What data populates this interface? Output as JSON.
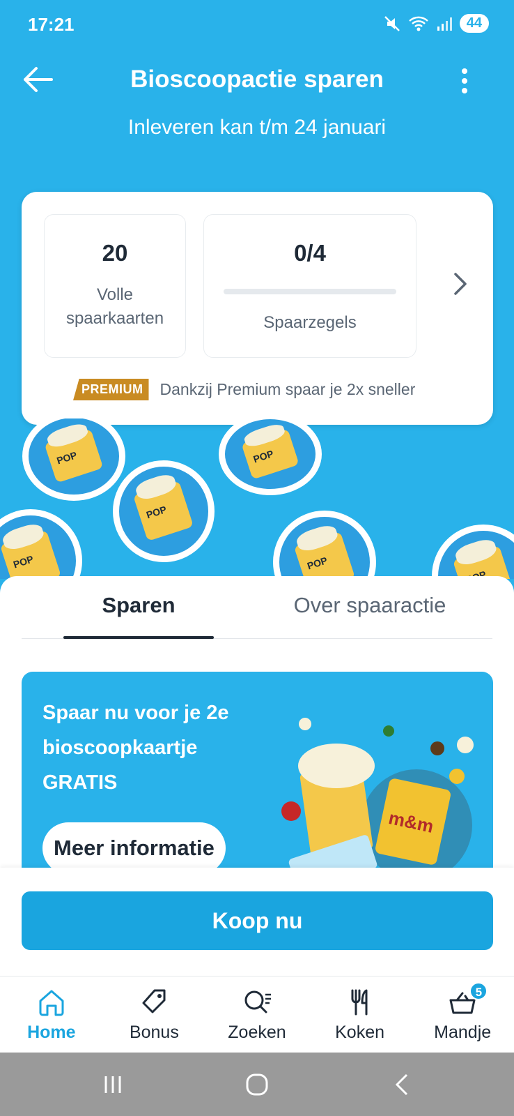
{
  "status_bar": {
    "time": "17:21",
    "battery": "44"
  },
  "header": {
    "title": "Bioscoopactie sparen",
    "subtitle": "Inleveren kan t/m 24 januari"
  },
  "savings": {
    "full_cards_value": "20",
    "full_cards_label_line1": "Volle",
    "full_cards_label_line2": "spaarkaarten",
    "stamps_value": "0/4",
    "stamps_progress": 0,
    "stamps_label": "Spaarzegels",
    "premium_badge": "PREMIUM",
    "premium_text": "Dankzij Premium spaar je 2x sneller"
  },
  "tabs": {
    "active": "Sparen",
    "other": "Over spaaractie"
  },
  "promo": {
    "line1": "Spaar nu voor je 2e",
    "line2": "bioscoopkaartje",
    "line3": "GRATIS",
    "button": "Meer informatie"
  },
  "cta": {
    "buy_label": "Koop nu"
  },
  "bottom_nav": {
    "items": [
      {
        "label": "Home",
        "icon": "home-icon"
      },
      {
        "label": "Bonus",
        "icon": "tag-icon"
      },
      {
        "label": "Zoeken",
        "icon": "search-icon"
      },
      {
        "label": "Koken",
        "icon": "cutlery-icon"
      },
      {
        "label": "Mandje",
        "icon": "basket-icon"
      }
    ],
    "cart_count": "5"
  },
  "colors": {
    "brand": "#29b2ea",
    "button": "#1aa5df",
    "premium": "#c98b22",
    "text": "#1f2a37"
  }
}
